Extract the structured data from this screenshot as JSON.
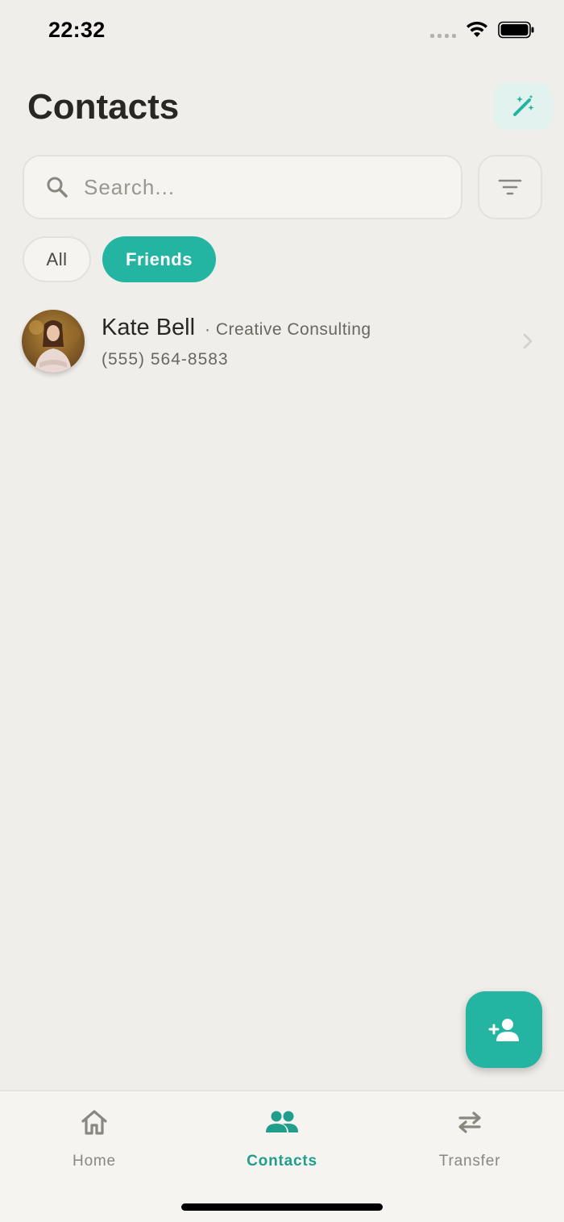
{
  "status_bar": {
    "time": "22:32"
  },
  "header": {
    "title": "Contacts",
    "magic_icon": "magic-wand-icon"
  },
  "search": {
    "placeholder": "Search...",
    "value": ""
  },
  "filter": {
    "icon": "filter-icon"
  },
  "chips": [
    {
      "label": "All",
      "selected": false
    },
    {
      "label": "Friends",
      "selected": true
    }
  ],
  "contacts": [
    {
      "name": "Kate Bell",
      "company": "· Creative Consulting",
      "phone": "(555) 564-8583"
    }
  ],
  "fab": {
    "icon": "add-person-icon"
  },
  "nav": {
    "items": [
      {
        "label": "Home",
        "icon": "home-icon",
        "active": false
      },
      {
        "label": "Contacts",
        "icon": "people-icon",
        "active": true
      },
      {
        "label": "Transfer",
        "icon": "swap-arrows-icon",
        "active": false
      }
    ]
  },
  "colors": {
    "accent": "#23b5a1",
    "accent_text": "#1f9e8c",
    "background": "#f0eeea"
  }
}
